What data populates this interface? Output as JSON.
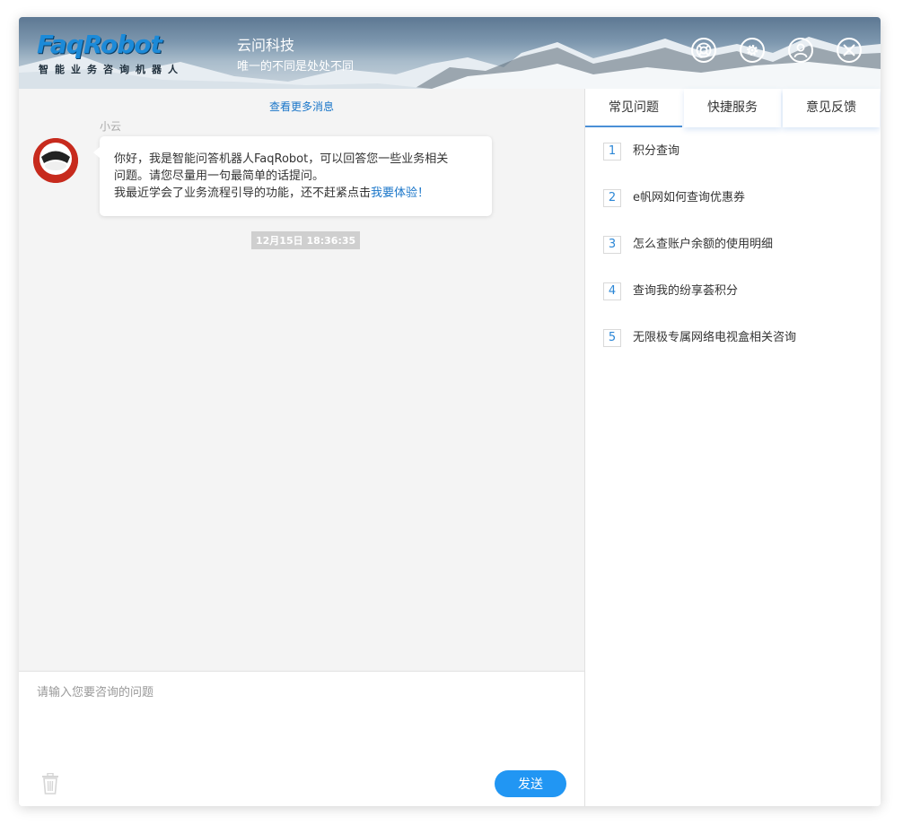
{
  "header": {
    "logo_text": "FaqRobot",
    "logo_subtitle": "智能业务咨询机器人",
    "brand_name": "云问科技",
    "slogan": "唯一的不同是处处不同",
    "buttons": [
      {
        "icon": "lifebuoy-icon"
      },
      {
        "icon": "gear-icon"
      },
      {
        "icon": "user-icon"
      },
      {
        "icon": "close-icon"
      }
    ]
  },
  "chat": {
    "more_messages": "查看更多消息",
    "sender_name": "小云",
    "message_line1": "你好，我是智能问答机器人FaqRobot，可以回答您一些业务相关",
    "message_line2": "问题。请您尽量用一句最简单的话提问。",
    "message_line3": "我最近学会了业务流程引导的功能，还不赶紧点击",
    "message_link": "我要体验！",
    "timestamp": "12月15日 18:36:35"
  },
  "input": {
    "placeholder": "请输入您要咨询的问题",
    "value": "",
    "send_label": "发送"
  },
  "side": {
    "tabs": [
      {
        "label": "常见问题",
        "active": true
      },
      {
        "label": "快捷服务",
        "active": false
      },
      {
        "label": "意见反馈",
        "active": false
      }
    ],
    "faq": [
      {
        "num": "1",
        "text": "积分查询"
      },
      {
        "num": "2",
        "text": "e帆网如何查询优惠券"
      },
      {
        "num": "3",
        "text": "怎么查账户余额的使用明细"
      },
      {
        "num": "4",
        "text": "查询我的纷享荟积分"
      },
      {
        "num": "5",
        "text": "无限极专属网络电视盒相关咨询"
      }
    ]
  },
  "colors": {
    "accent": "#2196f3",
    "link": "#1a76c9",
    "brand_blue": "#1c8ad8"
  }
}
